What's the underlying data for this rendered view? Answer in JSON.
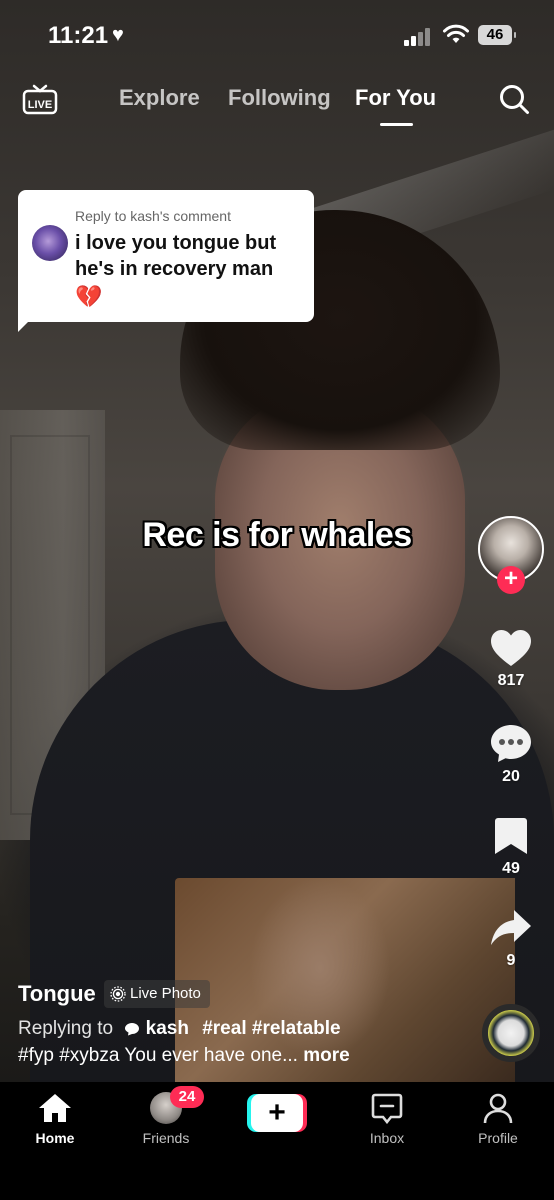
{
  "status_bar": {
    "time": "11:21",
    "battery": "46"
  },
  "top_nav": {
    "live_label": "LIVE",
    "tabs": [
      {
        "label": "Explore"
      },
      {
        "label": "Following"
      },
      {
        "label": "For You",
        "active": true
      }
    ]
  },
  "reply_card": {
    "header": "Reply to kash's comment",
    "text": "i love you tongue but he's in recovery man",
    "emoji": "💔"
  },
  "video": {
    "caption": "Rec is for whales"
  },
  "actions": {
    "likes": "817",
    "comments": "20",
    "bookmarks": "49",
    "shares": "9"
  },
  "post": {
    "author": "Tongue",
    "live_photo_label": "Live Photo",
    "replying_prefix": "Replying to",
    "replying_user": "kash",
    "hashtags_line1": "#real #relatable",
    "line2": "#fyp #xybza You ever have one...",
    "more": "more"
  },
  "tab_bar": {
    "home": "Home",
    "friends": "Friends",
    "friends_badge": "24",
    "create": "+",
    "inbox": "Inbox",
    "profile": "Profile"
  },
  "colors": {
    "accent_red": "#fe2c55",
    "accent_cyan": "#25f4ee"
  },
  "icons": [
    "heart-icon",
    "signal-icon",
    "wifi-icon",
    "live-tv-icon",
    "search-icon",
    "like-heart-icon",
    "comment-icon",
    "bookmark-icon",
    "share-icon",
    "home-icon",
    "inbox-icon",
    "profile-icon",
    "live-photo-icon",
    "comment-bubble-icon"
  ]
}
